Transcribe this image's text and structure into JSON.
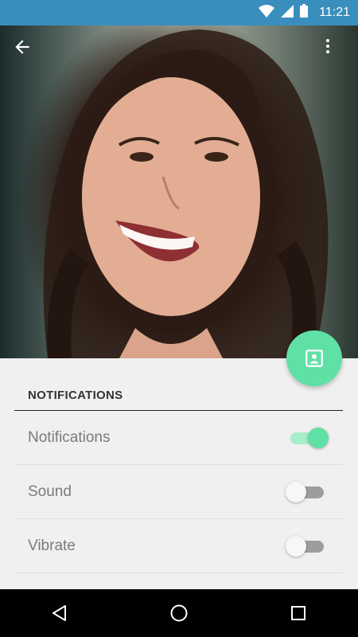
{
  "status_bar": {
    "time": "11:21",
    "icons": [
      "wifi-icon",
      "signal-icon",
      "battery-icon"
    ]
  },
  "header": {
    "back_icon": "arrow-back-icon",
    "menu_icon": "more-vert-icon"
  },
  "fab": {
    "icon": "contact-card-icon",
    "color": "#5fe0a5"
  },
  "section": {
    "title": "NOTIFICATIONS"
  },
  "settings": [
    {
      "label": "Notifications",
      "enabled": true
    },
    {
      "label": "Sound",
      "enabled": false
    },
    {
      "label": "Vibrate",
      "enabled": false
    }
  ],
  "colors": {
    "status_bar": "#3a8ebd",
    "accent": "#5fe0a5",
    "background": "#f0f0f0",
    "nav_bar": "#000000"
  },
  "nav_bar": {
    "icons": [
      "back-triangle-icon",
      "home-circle-icon",
      "recents-square-icon"
    ]
  }
}
